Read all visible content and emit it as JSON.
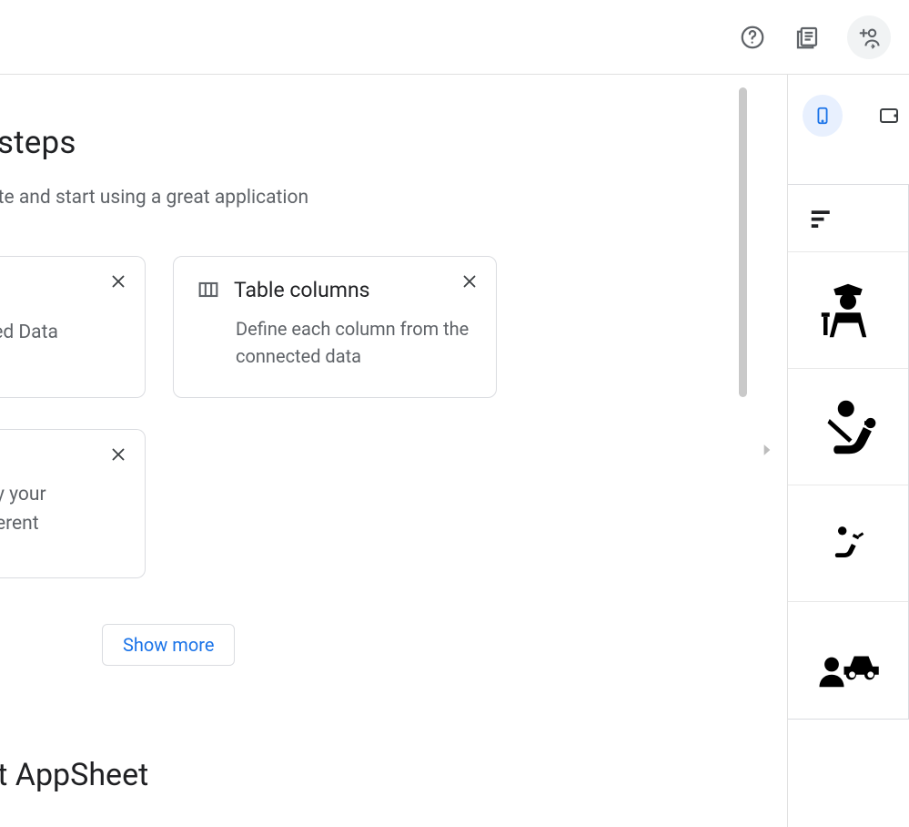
{
  "topbar": {
    "help_label": "Help",
    "docs_label": "Docs",
    "share_label": "Share"
  },
  "next_steps": {
    "heading": "ext steps",
    "sub": "o create and start using a great application",
    "cards": [
      {
        "title_partial": "nnected Data",
        "desc": ""
      },
      {
        "title": "Table columns",
        "desc": "Define each column from the connected data"
      },
      {
        "desc_partial": "ne way your\nth different"
      }
    ],
    "show_more": "Show more"
  },
  "about": {
    "heading": "bout AppSheet"
  },
  "preview": {
    "modes": {
      "phone": "Phone",
      "tablet": "Tablet"
    },
    "menu_icon": "menu",
    "rows": [
      "police-officer",
      "driver-seated",
      "child-seat",
      "pedestrian-car"
    ]
  }
}
